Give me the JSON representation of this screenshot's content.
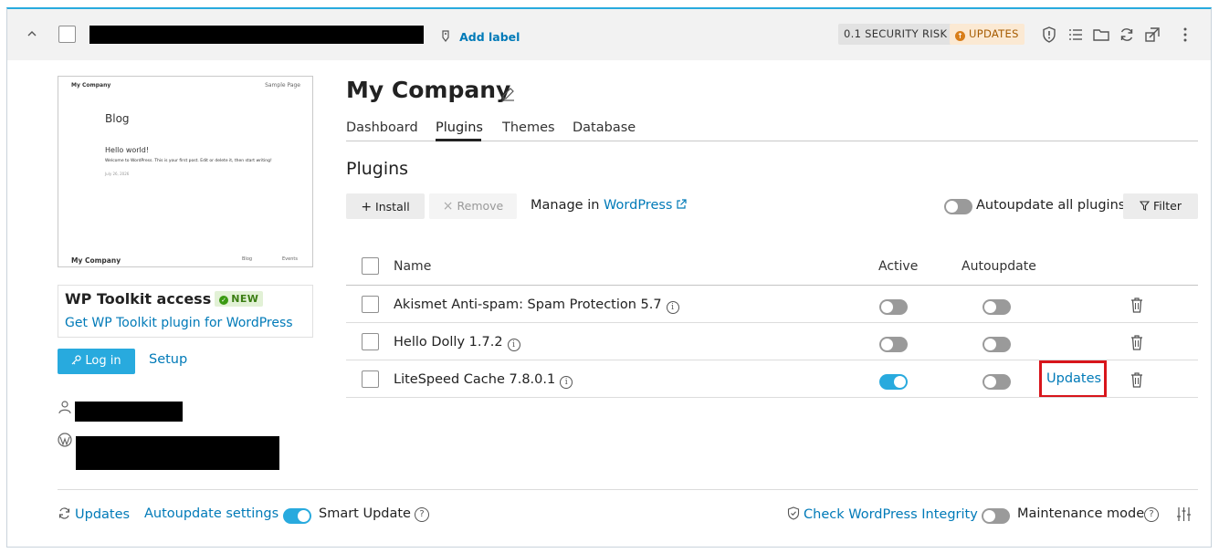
{
  "header": {
    "add_label": "Add label",
    "security_badge": "0.1 SECURITY RISK",
    "updates_badge": "UPDATES"
  },
  "preview": {
    "site_name": "My Company",
    "sample_page": "Sample Page",
    "blog": "Blog",
    "post_title": "Hello world!",
    "post_text": "Welcome to WordPress. This is your first post. Edit or delete it, then start writing!",
    "post_date": "July 26, 2026",
    "footer_name": "My Company",
    "footer_blog": "Blog",
    "footer_events": "Events"
  },
  "toolkit": {
    "title": "WP Toolkit access",
    "new_badge": "NEW",
    "get_link": "Get WP Toolkit plugin for WordPress",
    "login": "Log in",
    "setup": "Setup"
  },
  "site": {
    "title": "My Company"
  },
  "tabs": [
    {
      "label": "Dashboard"
    },
    {
      "label": "Plugins"
    },
    {
      "label": "Themes"
    },
    {
      "label": "Database"
    }
  ],
  "plugins": {
    "section_title": "Plugins",
    "install": "Install",
    "remove": "Remove",
    "manage_prefix": "Manage in",
    "manage_link": "WordPress",
    "autoupdate_all": "Autoupdate all plugins",
    "filter": "Filter",
    "columns": {
      "name": "Name",
      "active": "Active",
      "autoupdate": "Autoupdate"
    },
    "rows": [
      {
        "name": "Akismet Anti-spam: Spam Protection 5.7",
        "active": false,
        "autoupdate": false,
        "update": ""
      },
      {
        "name": "Hello Dolly 1.7.2",
        "active": false,
        "autoupdate": false,
        "update": ""
      },
      {
        "name": "LiteSpeed Cache 7.8.0.1",
        "active": true,
        "autoupdate": false,
        "update": "Updates"
      }
    ]
  },
  "footer": {
    "updates": "Updates",
    "autoupdate_settings": "Autoupdate settings",
    "smart_update": "Smart Update",
    "check_integrity": "Check WordPress Integrity",
    "maintenance_mode": "Maintenance mode"
  }
}
